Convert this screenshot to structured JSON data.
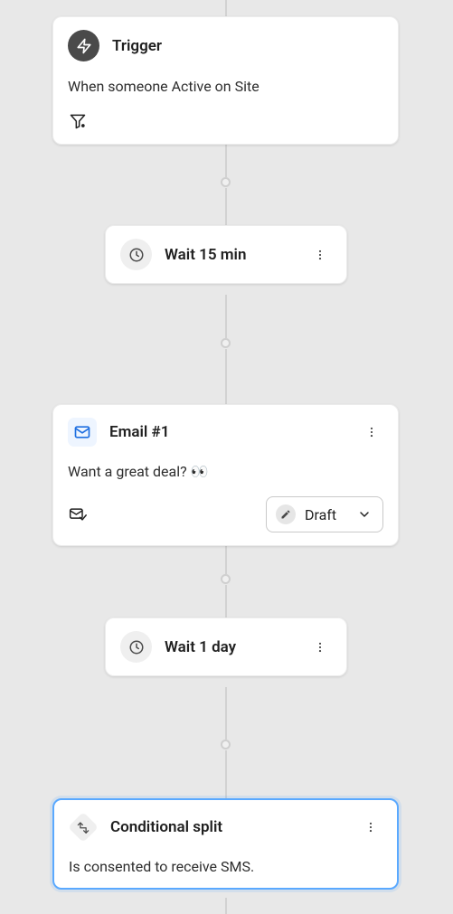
{
  "nodes": {
    "trigger": {
      "title": "Trigger",
      "description": "When someone Active on Site"
    },
    "wait1": {
      "label": "Wait 15 min"
    },
    "email1": {
      "title": "Email #1",
      "subject": "Want a great deal? 👀",
      "status_label": "Draft"
    },
    "wait2": {
      "label": "Wait 1 day"
    },
    "conditional": {
      "title": "Conditional split",
      "description": "Is consented to receive SMS."
    }
  }
}
